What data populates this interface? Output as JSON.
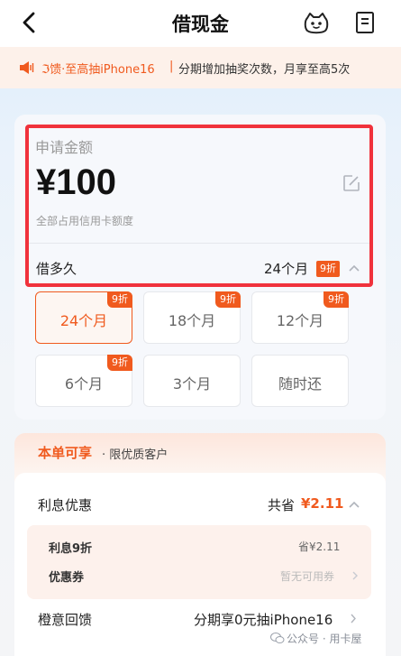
{
  "header": {
    "title": "借现金",
    "back_icon": "back-arrow-icon",
    "robot_icon": "robot-assistant-icon",
    "doc_icon": "document-icon"
  },
  "notice": {
    "icon": "speaker-icon",
    "highlight": "ℑ馈·至高抽iPhone16",
    "separator": "|",
    "text": "分期增加抽奖次数，月享至高5次"
  },
  "loan": {
    "label": "申请金额",
    "amount": "¥100",
    "sub": "全部占用信用卡额度",
    "term_label": "借多久",
    "term_value": "24个月",
    "term_badge": "9折",
    "options": [
      {
        "label": "24个月",
        "badge": "9折"
      },
      {
        "label": "18个月",
        "badge": "9折"
      },
      {
        "label": "12个月",
        "badge": "9折"
      },
      {
        "label": "6个月",
        "badge": "9折"
      },
      {
        "label": "3个月",
        "badge": ""
      },
      {
        "label": "随时还",
        "badge": ""
      }
    ]
  },
  "benefit": {
    "title": "本单可享",
    "subtitle": "· 限优质客户",
    "interest_label": "利息优惠",
    "interest_save": "共省",
    "interest_amount": "¥2.11",
    "discount_label": "利息9折",
    "discount_value": "省¥2.11",
    "coupon_label": "优惠券",
    "coupon_value": "暂无可用券",
    "reward_label": "橙意回馈",
    "reward_value": "分期享0元抽iPhone16"
  },
  "watermark": "公众号 · 用卡屋",
  "colors": {
    "accent": "#f05a1e",
    "highlight_border": "#f0323c"
  }
}
